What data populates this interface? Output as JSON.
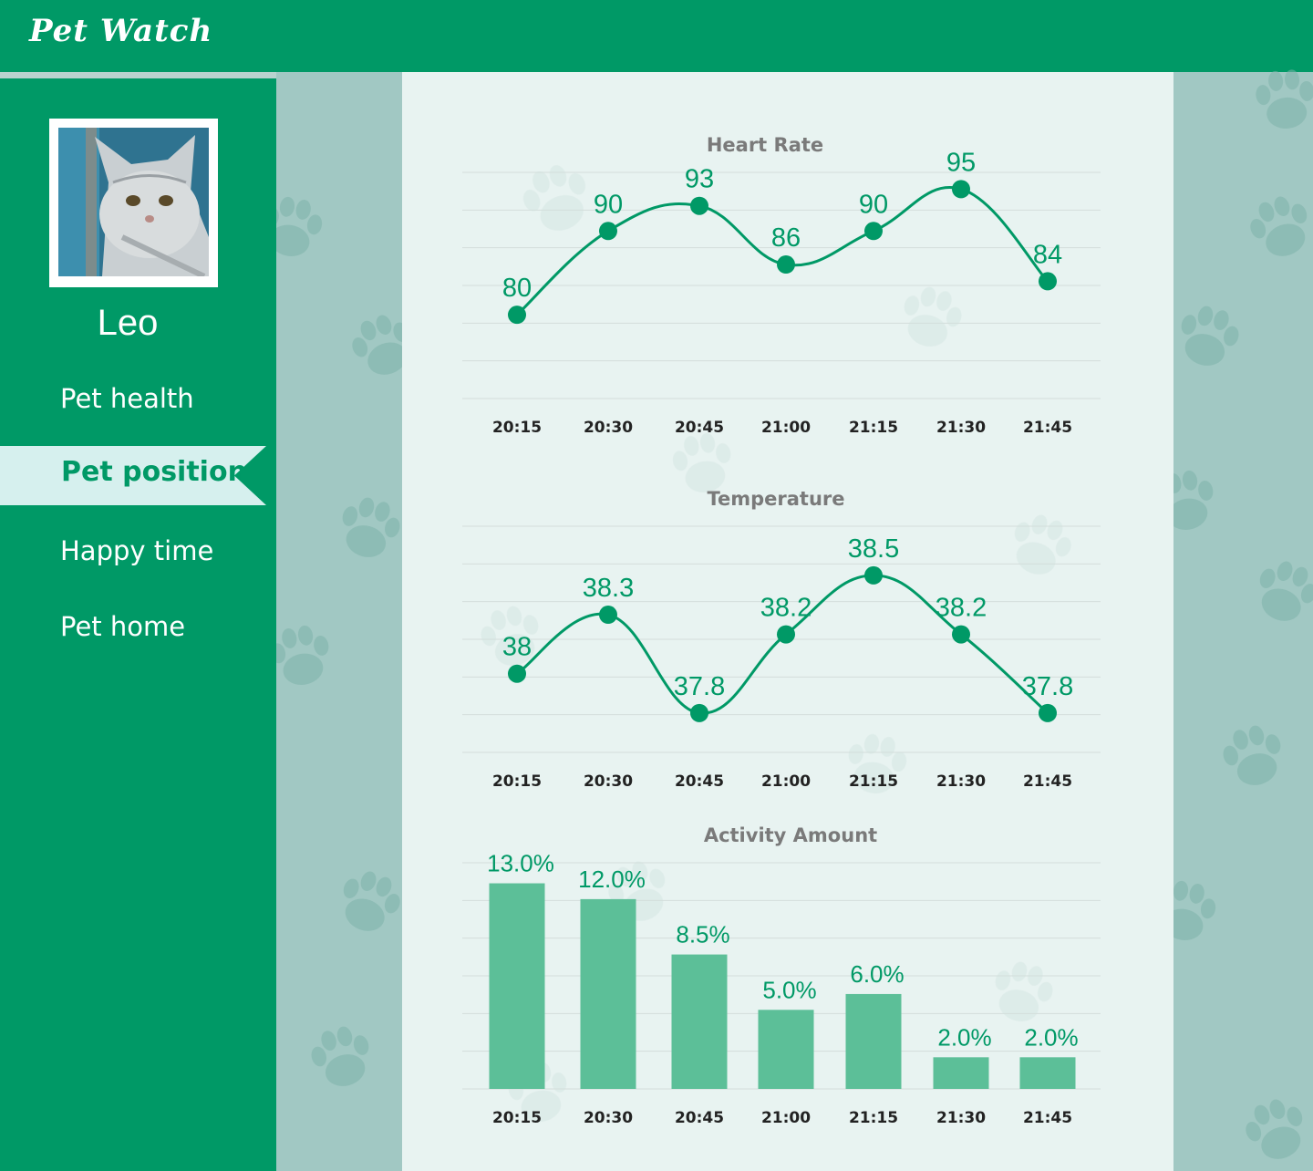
{
  "app": {
    "title": "Pet Watch"
  },
  "sidebar": {
    "pet_name": "Leo",
    "items": [
      {
        "label": "Pet health",
        "active": false
      },
      {
        "label": "Pet position",
        "active": true
      },
      {
        "label": "Happy time",
        "active": false
      },
      {
        "label": "Pet home",
        "active": false
      }
    ]
  },
  "colors": {
    "primary": "#009966",
    "active_bg": "#d6f0ee",
    "content_bg": "#e8f3f1",
    "page_bg": "#a1c8c3",
    "bar": "#5cbf98",
    "line": "#009966"
  },
  "chart_data": [
    {
      "type": "line",
      "title": "Heart Rate",
      "categories": [
        "20:15",
        "20:30",
        "20:45",
        "21:00",
        "21:15",
        "21:30",
        "21:45"
      ],
      "values": [
        80,
        90,
        93,
        86,
        90,
        95,
        84
      ],
      "labels": [
        "80",
        "90",
        "93",
        "86",
        "90",
        "95",
        "84"
      ],
      "ylim": [
        70,
        97
      ],
      "grid": true
    },
    {
      "type": "line",
      "title": "Temperature",
      "categories": [
        "20:15",
        "20:30",
        "20:45",
        "21:00",
        "21:15",
        "21:30",
        "21:45"
      ],
      "values": [
        38,
        38.3,
        37.8,
        38.2,
        38.5,
        38.2,
        37.8
      ],
      "labels": [
        "38",
        "38.3",
        "37.8",
        "38.2",
        "38.5",
        "38.2",
        "37.8"
      ],
      "ylim": [
        37.6,
        38.75
      ],
      "grid": true
    },
    {
      "type": "bar",
      "title": "Activity Amount",
      "categories": [
        "20:15",
        "20:30",
        "20:45",
        "21:00",
        "21:15",
        "21:30",
        "21:45"
      ],
      "values": [
        13.0,
        12.0,
        8.5,
        5.0,
        6.0,
        2.0,
        2.0
      ],
      "labels": [
        "13.0%",
        "12.0%",
        "8.5%",
        "5.0%",
        "6.0%",
        "2.0%",
        "2.0%"
      ],
      "ylim": [
        0,
        14.3
      ],
      "grid": true
    }
  ]
}
